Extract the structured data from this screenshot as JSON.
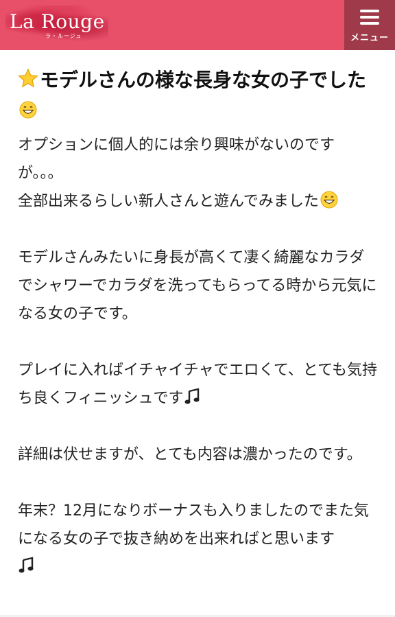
{
  "header": {
    "logo_text": "La Rouge",
    "logo_sub": "ラ・ルージュ",
    "menu_label": "メニュー",
    "brand_color": "#e8506a",
    "menu_bg_color": "#9e3a4a"
  },
  "article": {
    "title": "モデルさんの様な長身な女の子でした",
    "title_icons": [
      "star-icon",
      "grinning-face-icon"
    ],
    "paragraphs": [
      {
        "text": "オプションに個人的には余り興味がないのですが。。。\n全部出来るらしい新人さんと遊んでみました",
        "icon": "grinning-face-icon"
      },
      {
        "text": "モデルさんみたいに身長が高くて凄く綺麗なカラダでシャワーでカラダを洗ってもらってる時から元気になる女の子です。",
        "icon": ""
      },
      {
        "text": "プレイに入ればイチャイチャでエロくて、とても気持ち良くフィニッシュです",
        "icon": "musical-note-icon"
      },
      {
        "text": "詳細は伏せますが、とても内容は濃かったのです。",
        "icon": ""
      },
      {
        "text": "年末？12月になりボーナスも入りましたのでまた気になる女の子で抜き納めを出来ればと思います",
        "icon": "musical-note-icon"
      }
    ]
  }
}
